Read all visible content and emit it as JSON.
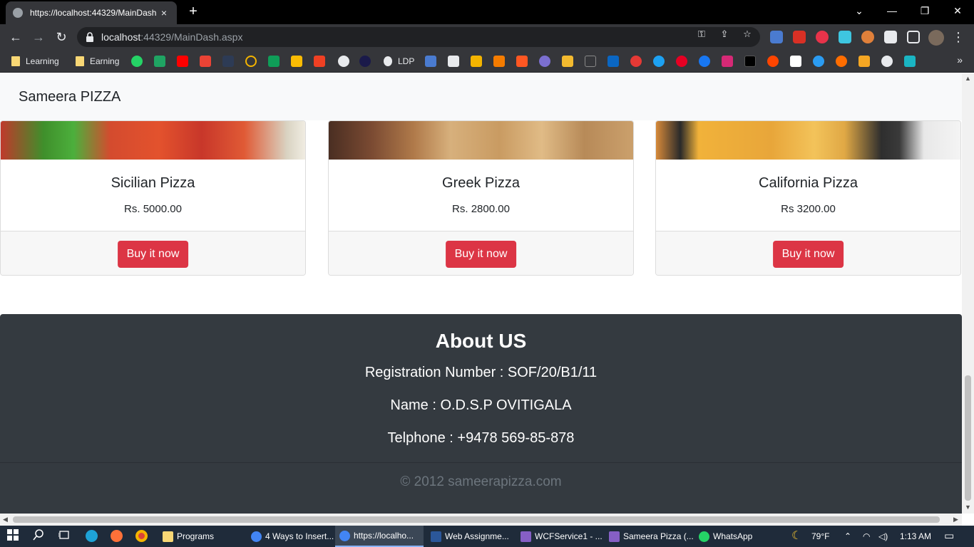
{
  "browser": {
    "tab_title": "https://localhost:44329/MainDash",
    "tab_close": "×",
    "new_tab": "+",
    "url_host": "localhost",
    "url_path": ":44329/MainDash.aspx",
    "window": {
      "minimize": "—",
      "restore": "❐",
      "close": "✕",
      "tabs_dropdown": "⌄"
    },
    "nav": {
      "back": "←",
      "forward": "→",
      "reload": "↻"
    }
  },
  "bookmarks": {
    "learning": "Learning",
    "earning": "Earning",
    "ldp": "LDP",
    "more": "»"
  },
  "site": {
    "brand": "Sameera PIZZA",
    "products": [
      {
        "name": "Sicilian Pizza",
        "price": "Rs. 5000.00",
        "button": "Buy it now"
      },
      {
        "name": "Greek Pizza",
        "price": "Rs. 2800.00",
        "button": "Buy it now"
      },
      {
        "name": "California Pizza",
        "price": "Rs 3200.00",
        "button": "Buy it now"
      }
    ],
    "footer": {
      "title": "About US",
      "registration": "Registration Number : SOF/20/B1/11",
      "name": "Name : O.D.S.P OVITIGALA",
      "phone": "Telphone : +9478 569-85-878",
      "copyright": "© 2012 sameerapizza.com"
    }
  },
  "taskbar": {
    "apps": [
      {
        "label": "Programs",
        "color": "#f8d775"
      },
      {
        "label": "4 Ways to Insert...",
        "color": "#4285f4"
      },
      {
        "label": "https://localho...",
        "color": "#4285f4",
        "active": true
      },
      {
        "label": "Web Assignme...",
        "color": "#2b579a"
      },
      {
        "label": "WCFService1 - ...",
        "color": "#865fc5"
      },
      {
        "label": "Sameera Pizza (...",
        "color": "#865fc5"
      },
      {
        "label": "WhatsApp",
        "color": "#25d366"
      }
    ],
    "weather": "79°F",
    "time": "1:13 AM"
  },
  "colors": {
    "buy_button": "#dc3545",
    "footer_bg": "#343a40",
    "navbar_bg": "#f8f9fa"
  }
}
